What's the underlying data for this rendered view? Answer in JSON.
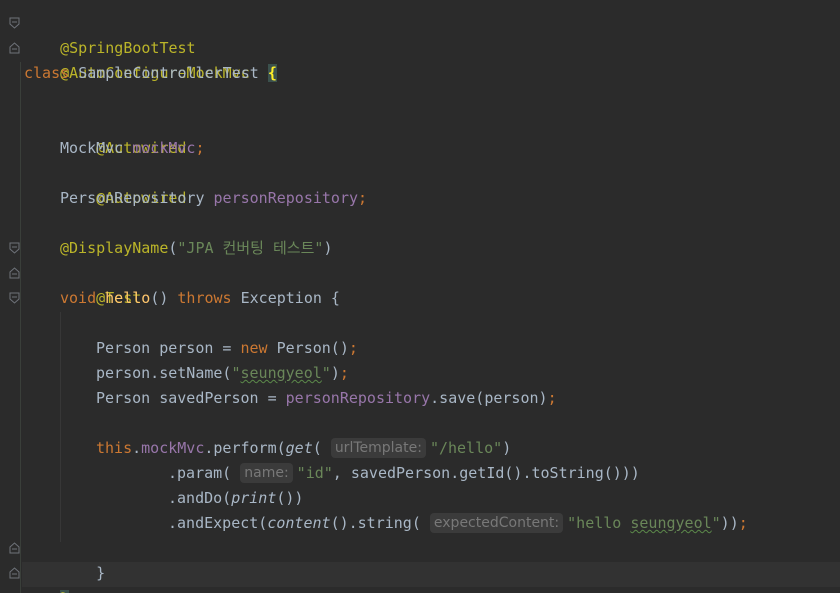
{
  "code": {
    "l1": {
      "annotation": "@SpringBootTest"
    },
    "l2": {
      "annotation": "@AutoConfigureMockMvc"
    },
    "l3": {
      "kw": "class",
      "name": "SampleControllerTest",
      "brace": "{"
    },
    "l5": {
      "annotation": "@Autowired"
    },
    "l6": {
      "type": "MockMvc",
      "field": "mockMvc",
      "semi": ";"
    },
    "l7": {
      "annotation": "@Autowired"
    },
    "l8": {
      "type": "PersonRepository",
      "field": "personRepository",
      "semi": ";"
    },
    "l10": {
      "annotation": "@DisplayName",
      "open": "(",
      "str": "\"JPA 컨버팅 테스트\"",
      "close": ")"
    },
    "l11": {
      "annotation": "@Test"
    },
    "l12": {
      "kw1": "void",
      "method": "hello",
      "paren": "()",
      "kw2": "throws",
      "rest": "Exception {"
    },
    "l14": {
      "pre": "Person person = ",
      "kw": "new",
      "post": " Person()",
      "semi": ";"
    },
    "l15": {
      "pre": "person.setName(",
      "q1": "\"",
      "str": "seungyeol",
      "q2": "\"",
      "post": ")",
      "semi": ";"
    },
    "l16": {
      "pre": "Person savedPerson = ",
      "field": "personRepository",
      "post": ".save(person)",
      "semi": ";"
    },
    "l18": {
      "kw": "this",
      "dot": ".",
      "field": "mockMvc",
      "mid": ".perform(",
      "call": "get",
      "open": "(",
      "hint": "urlTemplate:",
      "str": "\"/hello\"",
      "close": ")"
    },
    "l19": {
      "pre": ".param(",
      "hint": "name:",
      "str": "\"id\"",
      "post": ", savedPerson.getId().toString()))"
    },
    "l20": {
      "pre": ".andDo(",
      "call": "print",
      "post": "())"
    },
    "l21": {
      "pre": ".andExpect(",
      "call": "content",
      "mid": "().string(",
      "hint": "expectedContent:",
      "str1": "\"hello ",
      "str2": "seungyeol",
      "str3": "\"",
      "post": "))",
      "semi": ";"
    },
    "l22": {
      "brace": "}"
    },
    "l23": {
      "brace": "}"
    }
  },
  "colors": {
    "background": "#2b2b2b",
    "keyword": "#cc7832",
    "annotation": "#bbb529",
    "field": "#9876aa",
    "string": "#6a8759",
    "method": "#ffc66d",
    "text": "#a9b7c6"
  },
  "icons": [
    "fold-start-icon",
    "fold-end-icon"
  ]
}
